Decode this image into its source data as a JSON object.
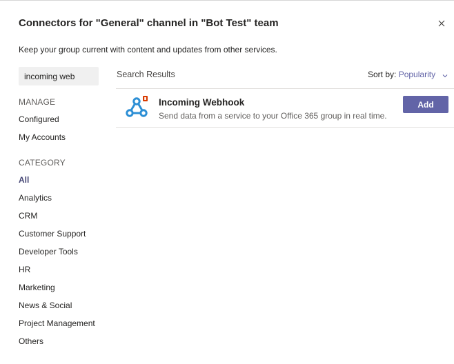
{
  "dialog": {
    "title": "Connectors for \"General\" channel in \"Bot Test\" team",
    "subtitle": "Keep your group current with content and updates from other services.",
    "close_icon": "close-icon"
  },
  "search": {
    "value": "incoming web"
  },
  "sidebar": {
    "manage_heading": "MANAGE",
    "manage_items": [
      {
        "label": "Configured"
      },
      {
        "label": "My Accounts"
      }
    ],
    "category_heading": "CATEGORY",
    "category_items": [
      {
        "label": "All",
        "active": true
      },
      {
        "label": "Analytics"
      },
      {
        "label": "CRM"
      },
      {
        "label": "Customer Support"
      },
      {
        "label": "Developer Tools"
      },
      {
        "label": "HR"
      },
      {
        "label": "Marketing"
      },
      {
        "label": "News & Social"
      },
      {
        "label": "Project Management"
      },
      {
        "label": "Others"
      }
    ]
  },
  "results": {
    "label": "Search Results",
    "sort_label": "Sort by:",
    "sort_value": "Popularity",
    "items": [
      {
        "icon": "webhook-icon",
        "badge_icon": "office-badge-icon",
        "title": "Incoming Webhook",
        "description": "Send data from a service to your Office 365 group in real time.",
        "action_label": "Add"
      }
    ]
  },
  "colors": {
    "accent": "#6264a7",
    "active_category": "#464775",
    "webhook_icon": "#2d8fd5",
    "office_badge": "#d83b01"
  }
}
